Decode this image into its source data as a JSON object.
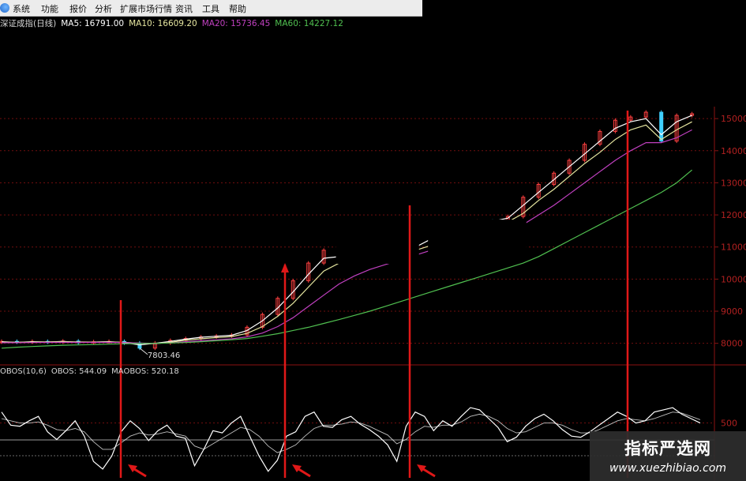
{
  "menu": {
    "items": [
      "系统",
      "功能",
      "报价",
      "分析",
      "扩展市场行情",
      "资讯",
      "工具",
      "帮助"
    ]
  },
  "header": {
    "title": "深证成指(日线)",
    "ma5": "MA5: 16791.00",
    "ma10": "MA10: 16609.20",
    "ma20": "MA20: 15736.45",
    "ma60": "MA60: 14227.12"
  },
  "indicator": {
    "name": "OBOS(10,6)",
    "obos": "OBOS: 544.09",
    "maobos": "MAOBOS: 520.18"
  },
  "watermark": {
    "title": "指标严选网",
    "url": "www.xuezhibiao.com"
  },
  "colors": {
    "background": "#000000",
    "axis_red": "#8b1212",
    "signal_red": "#e01818",
    "ma5": "#ffffff",
    "ma10": "#e6e6a0",
    "ma20": "#c040c0",
    "ma60": "#50c050",
    "up_candle": "#ff4040",
    "down_candle": "#40d0ff",
    "obos": "#ffffff"
  },
  "chart_data": {
    "type": "line",
    "price_axis": {
      "ticks": [
        "15000",
        "14000",
        "13000",
        "12000",
        "11000",
        "10000",
        "9000",
        "8000"
      ],
      "ylim": [
        7500,
        15250
      ]
    },
    "low_annotation": "7803.46",
    "x_points": 46,
    "series": [
      {
        "name": "MA5",
        "color": "#ffffff",
        "values": [
          8050,
          8030,
          8050,
          8040,
          8060,
          8030,
          8040,
          8050,
          8020,
          7950,
          8000,
          8060,
          8130,
          8190,
          8220,
          8250,
          8400,
          8700,
          9100,
          9600,
          10150,
          10650,
          10700,
          10650,
          10750,
          10850,
          10900,
          11000,
          11250,
          11400,
          11550,
          11700,
          11800,
          11900,
          12300,
          12700,
          13100,
          13500,
          13900,
          14300,
          14700,
          14900,
          15000,
          14500,
          14900,
          15100
        ]
      },
      {
        "name": "MA10",
        "color": "#e6e6a0",
        "values": [
          8040,
          8035,
          8040,
          8045,
          8050,
          8045,
          8040,
          8045,
          8035,
          8000,
          7990,
          8030,
          8100,
          8140,
          8180,
          8210,
          8310,
          8520,
          8840,
          9250,
          9750,
          10250,
          10500,
          10550,
          10600,
          10700,
          10800,
          10900,
          11050,
          11250,
          11400,
          11550,
          11680,
          11780,
          12050,
          12450,
          12800,
          13200,
          13600,
          13950,
          14350,
          14650,
          14800,
          14350,
          14650,
          14900
        ]
      },
      {
        "name": "MA20",
        "color": "#c040c0",
        "values": [
          8020,
          8020,
          8025,
          8030,
          8030,
          8030,
          8030,
          8030,
          8025,
          8010,
          8000,
          8010,
          8050,
          8080,
          8110,
          8140,
          8200,
          8320,
          8520,
          8800,
          9150,
          9500,
          9850,
          10100,
          10300,
          10450,
          10600,
          10750,
          10900,
          11050,
          11200,
          11350,
          11450,
          11550,
          11700,
          12000,
          12300,
          12650,
          13000,
          13350,
          13700,
          14000,
          14250,
          14250,
          14400,
          14650
        ]
      },
      {
        "name": "MA60",
        "color": "#50c050",
        "values": [
          7850,
          7880,
          7900,
          7920,
          7940,
          7950,
          7960,
          7975,
          7985,
          7995,
          8000,
          8010,
          8025,
          8050,
          8080,
          8110,
          8150,
          8220,
          8300,
          8400,
          8500,
          8620,
          8740,
          8870,
          9000,
          9150,
          9300,
          9450,
          9600,
          9750,
          9900,
          10050,
          10200,
          10350,
          10500,
          10700,
          10950,
          11200,
          11450,
          11700,
          11950,
          12200,
          12450,
          12700,
          13000,
          13400
        ]
      }
    ],
    "candles_close": [
      8060,
      8040,
      8060,
      8040,
      8070,
      8020,
      8050,
      8060,
      8010,
      7850,
      8010,
      8090,
      8150,
      8200,
      8230,
      8260,
      8500,
      8900,
      9400,
      9950,
      10500,
      10900,
      10700,
      10600,
      10900,
      10950,
      10800,
      11100,
      11400,
      11500,
      11600,
      11800,
      11700,
      11950,
      12550,
      12950,
      13300,
      13700,
      14200,
      14600,
      14950,
      15050,
      15200,
      14300,
      15100,
      15150
    ],
    "gaps": [
      {
        "from_index": 22,
        "to_index": 27
      },
      {
        "from_index": 28,
        "to_index": 34
      }
    ],
    "obos_axis": {
      "ticks": [
        "500"
      ],
      "ylim": [
        0,
        900
      ]
    },
    "obos_series": [
      {
        "name": "OBOS",
        "values": [
          600,
          480,
          470,
          520,
          560,
          420,
          350,
          430,
          520,
          380,
          150,
          80,
          200,
          420,
          520,
          450,
          340,
          430,
          480,
          380,
          360,
          110,
          260,
          430,
          410,
          500,
          560,
          380,
          200,
          60,
          160,
          380,
          420,
          560,
          600,
          470,
          460,
          530,
          560,
          490,
          440,
          380,
          300,
          150,
          470,
          600,
          560,
          430,
          520,
          470,
          560,
          640,
          620,
          540,
          460,
          330,
          370,
          470,
          540,
          580,
          520,
          440,
          380,
          370,
          420,
          480,
          540,
          600,
          560,
          500,
          520,
          600,
          620,
          640,
          580,
          540,
          500
        ]
      },
      {
        "name": "MAOBOS",
        "values": [
          540,
          520,
          500,
          500,
          510,
          480,
          440,
          430,
          450,
          420,
          330,
          260,
          260,
          320,
          380,
          410,
          390,
          400,
          420,
          400,
          380,
          290,
          260,
          310,
          360,
          410,
          460,
          440,
          380,
          290,
          230,
          260,
          300,
          380,
          450,
          480,
          480,
          490,
          510,
          500,
          470,
          430,
          390,
          310,
          350,
          420,
          470,
          460,
          480,
          480,
          510,
          560,
          580,
          560,
          520,
          450,
          410,
          420,
          460,
          500,
          500,
          480,
          440,
          410,
          410,
          440,
          480,
          520,
          540,
          530,
          520,
          540,
          570,
          600,
          590,
          560,
          530
        ]
      }
    ],
    "signals": [
      "bottom",
      "bottom",
      "bottom",
      "top"
    ]
  }
}
